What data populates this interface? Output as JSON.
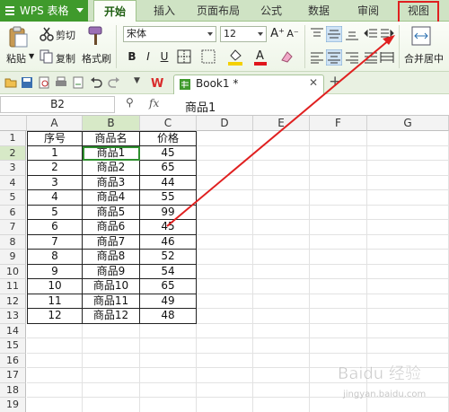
{
  "app": {
    "brand": "WPS 表格"
  },
  "tabs": [
    "开始",
    "插入",
    "页面布局",
    "公式",
    "数据",
    "审阅",
    "视图"
  ],
  "active_tab": "开始",
  "highlighted_tab": "视图",
  "ribbon": {
    "paste": "粘贴",
    "cut": "剪切",
    "copy": "复制",
    "format_painter": "格式刷",
    "font_name": "宋体",
    "font_size": "12",
    "bold": "B",
    "italic": "I",
    "underline": "U",
    "merge_center": "合并居中"
  },
  "document_tab": {
    "name": "Book1 *"
  },
  "formula_bar": {
    "cell_ref": "B2",
    "fx": "fx",
    "content": "商品1"
  },
  "columns": [
    "A",
    "B",
    "C",
    "D",
    "E",
    "F",
    "G"
  ],
  "row_numbers": [
    "1",
    "2",
    "3",
    "4",
    "5",
    "6",
    "7",
    "8",
    "9",
    "10",
    "11",
    "12",
    "13",
    "14",
    "15",
    "16",
    "17",
    "18",
    "19"
  ],
  "table": {
    "headers": [
      "序号",
      "商品名",
      "价格"
    ],
    "rows": [
      [
        "1",
        "商品1",
        "45"
      ],
      [
        "2",
        "商品2",
        "65"
      ],
      [
        "3",
        "商品3",
        "44"
      ],
      [
        "4",
        "商品4",
        "55"
      ],
      [
        "5",
        "商品5",
        "99"
      ],
      [
        "6",
        "商品6",
        "45"
      ],
      [
        "7",
        "商品7",
        "46"
      ],
      [
        "8",
        "商品8",
        "52"
      ],
      [
        "9",
        "商品9",
        "54"
      ],
      [
        "10",
        "商品10",
        "65"
      ],
      [
        "11",
        "商品11",
        "49"
      ],
      [
        "12",
        "商品12",
        "48"
      ]
    ]
  },
  "colors": {
    "brand_green": "#3f9a2c",
    "annotation_red": "#e02020",
    "selection_green": "#2f8f2f"
  },
  "watermark": {
    "text": "Baidu 经验",
    "url": "jingyan.baidu.com"
  }
}
